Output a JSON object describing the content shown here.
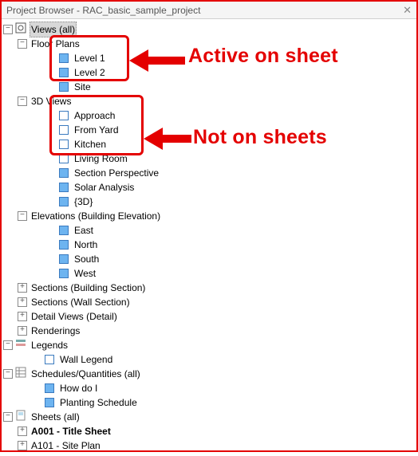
{
  "title": "Project Browser - RAC_basic_sample_project",
  "callouts": {
    "active": "Active on sheet",
    "not": "Not on sheets"
  },
  "root": {
    "label": "Views (all)"
  },
  "floorPlans": {
    "label": "Floor Plans",
    "items": [
      {
        "label": "Level 1",
        "filled": true
      },
      {
        "label": "Level 2",
        "filled": true
      },
      {
        "label": "Site",
        "filled": true
      }
    ]
  },
  "threeD": {
    "label": "3D Views",
    "items": [
      {
        "label": "Approach",
        "filled": false
      },
      {
        "label": "From Yard",
        "filled": false
      },
      {
        "label": "Kitchen",
        "filled": false
      },
      {
        "label": "Living Room",
        "filled": false
      },
      {
        "label": "Section Perspective",
        "filled": true
      },
      {
        "label": "Solar Analysis",
        "filled": true
      },
      {
        "label": "{3D}",
        "filled": true
      }
    ]
  },
  "elevations": {
    "label": "Elevations (Building Elevation)",
    "items": [
      {
        "label": "East",
        "filled": true
      },
      {
        "label": "North",
        "filled": true
      },
      {
        "label": "South",
        "filled": true
      },
      {
        "label": "West",
        "filled": true
      }
    ]
  },
  "collapsed": [
    "Sections (Building Section)",
    "Sections (Wall Section)",
    "Detail Views (Detail)",
    "Renderings"
  ],
  "legends": {
    "label": "Legends",
    "items": [
      {
        "label": "Wall Legend",
        "filled": false
      }
    ]
  },
  "schedules": {
    "label": "Schedules/Quantities (all)",
    "items": [
      {
        "label": "How do I",
        "filled": true
      },
      {
        "label": "Planting Schedule",
        "filled": true
      }
    ]
  },
  "sheets": {
    "label": "Sheets (all)",
    "items": [
      {
        "label": "A001 - Title Sheet",
        "bold": true
      },
      {
        "label": "A101 - Site Plan",
        "bold": false
      }
    ]
  }
}
